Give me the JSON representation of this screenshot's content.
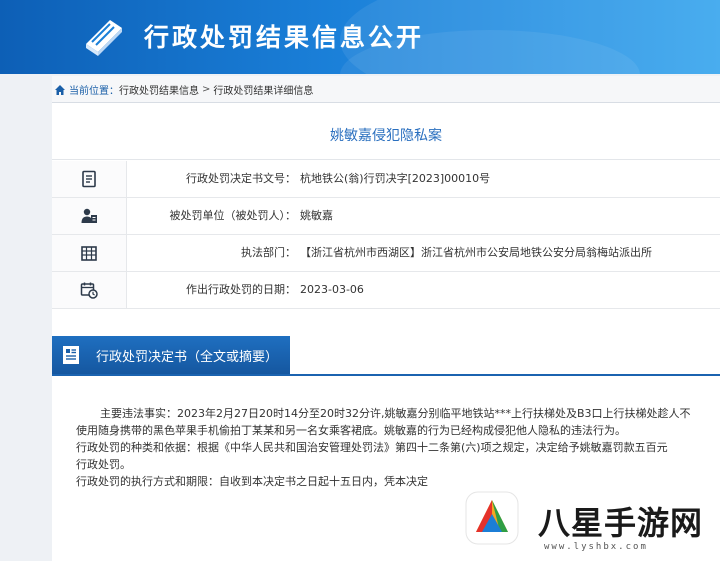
{
  "header": {
    "title": "行政处罚结果信息公开",
    "icon": "book-icon"
  },
  "breadcrumb": {
    "label": "当前位置：",
    "items": [
      "行政处罚结果信息",
      "行政处罚结果详细信息"
    ],
    "separator": ">"
  },
  "case": {
    "title": "姚敏嘉侵犯隐私案"
  },
  "info": [
    {
      "icon": "document-list-icon",
      "label": "行政处罚决定书文号：",
      "value": "杭地铁公(翁)行罚决字[2023]00010号"
    },
    {
      "icon": "user-id-icon",
      "label": "被处罚单位（被处罚人）：",
      "value": "姚敏嘉"
    },
    {
      "icon": "building-icon",
      "label": "执法部门：",
      "value": "【浙江省杭州市西湖区】浙江省杭州市公安局地铁公安分局翁梅站派出所"
    },
    {
      "icon": "calendar-clock-icon",
      "label": "作出行政处罚的日期：",
      "value": "2023-03-06"
    }
  ],
  "section": {
    "title": "行政处罚决定书（全文或摘要）",
    "icon": "document-icon"
  },
  "body": {
    "line1": "主要违法事实：2023年2月27日20时14分至20时32分许,姚敏嘉分别临平地铁站***上行扶梯处及B3口上行扶梯处趁人不",
    "line2": "使用随身携带的黑色苹果手机偷拍丁某某和另一名女乘客裙底。姚敏嘉的行为已经构成侵犯他人隐私的违法行为。",
    "line3": "行政处罚的种类和依据：根据《中华人民共和国治安管理处罚法》第四十二条第(六)项之规定，决定给予姚敏嘉罚款五百元",
    "line4": "行政处罚。",
    "line5": "行政处罚的执行方式和期限：自收到本决定书之日起十五日内，凭本决定"
  },
  "watermark": {
    "text": "八星手游网",
    "url": "www.lyshbx.com"
  }
}
